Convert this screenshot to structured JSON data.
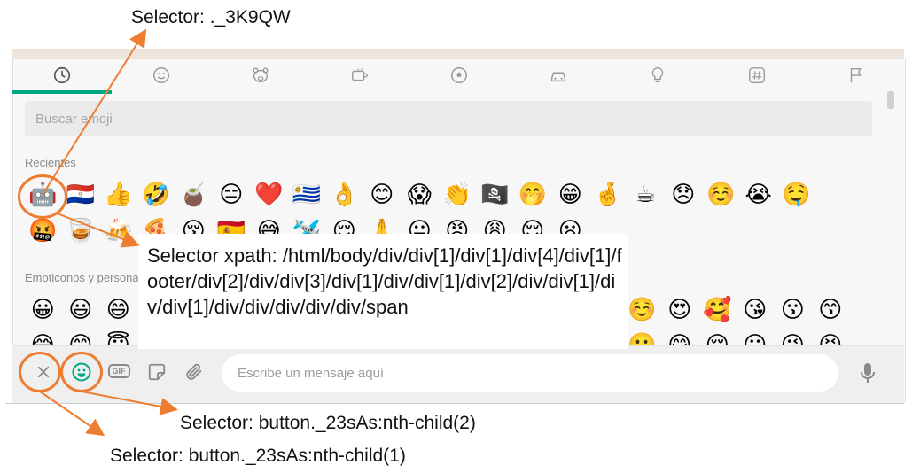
{
  "panel": {
    "tabs": [
      {
        "name": "recent",
        "icon": "clock-icon"
      },
      {
        "name": "smileys",
        "icon": "smiley-icon"
      },
      {
        "name": "animals",
        "icon": "bear-icon"
      },
      {
        "name": "food",
        "icon": "cup-icon"
      },
      {
        "name": "activity",
        "icon": "soccer-ball-icon"
      },
      {
        "name": "travel",
        "icon": "car-icon"
      },
      {
        "name": "objects",
        "icon": "lightbulb-icon"
      },
      {
        "name": "symbols",
        "icon": "hash-icon"
      },
      {
        "name": "flags",
        "icon": "flag-icon"
      }
    ],
    "search_placeholder": "Buscar emoji",
    "recent_title": "Recientes",
    "recent_row1": [
      "🤖",
      "🇵🇾",
      "👍",
      "🤣",
      "🧉",
      "😑",
      "❤️",
      "🇺🇾",
      "👌",
      "😊",
      "😱",
      "👏",
      "🏴‍☠️",
      "🤭",
      "😁",
      "🤞",
      "☕",
      "😞",
      "☺️",
      "😭",
      "🤤"
    ],
    "recent_row2": [
      "🤬",
      "🥃",
      "🍻",
      "🍕",
      "😚",
      "🇪🇸",
      "😅",
      "🛩️",
      "😌",
      "🙏",
      "😐",
      "😡",
      "😩",
      "😌",
      "😦"
    ],
    "smileys_title": "Emoticonos y personas",
    "smileys_row1_left": [
      "😀",
      "😃",
      "😄"
    ],
    "smileys_row1_right": [
      "☺️",
      "😍",
      "🥰",
      "😘",
      "😗",
      "😙"
    ],
    "smileys_row2_left": [
      "😂",
      "😊",
      "😇"
    ],
    "smileys_row2_right": [
      "🙂",
      "😋",
      "😌",
      "😛",
      "😜",
      "😝"
    ]
  },
  "footer": {
    "close_icon": "close-icon",
    "emoji_icon": "smiley-icon",
    "gif_label": "GIF",
    "sticker_icon": "sticker-icon",
    "attach_icon": "paperclip-icon",
    "message_placeholder": "Escribe un mensaje aquí",
    "mic_icon": "microphone-icon"
  },
  "annotations": {
    "top": "Selector: ._3K9QW",
    "xpath": "Selector xpath: /html/body/div/div[1]/div[1]/div[4]/div[1]/footer/div[2]/div/div[3]/div[1]/div/div[1]/div[2]/div/div[1]/div/div[1]/div/div/div/div/div/span",
    "button2": "Selector: button._23sAs:nth-child(2)",
    "button1": "Selector: button._23sAs:nth-child(1)",
    "accent_color": "#ed7d31"
  }
}
